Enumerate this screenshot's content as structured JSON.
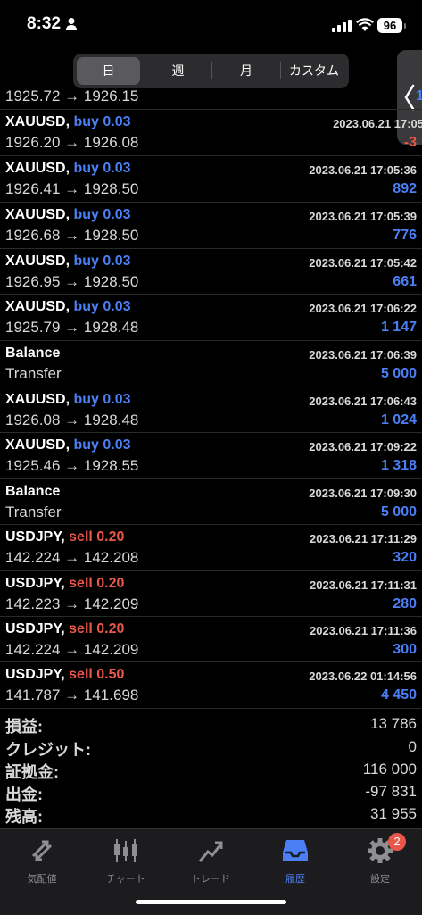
{
  "status": {
    "time": "8:32",
    "battery": "96"
  },
  "segments": [
    "日",
    "週",
    "月",
    "カスタム"
  ],
  "active_segment": 0,
  "rows": [
    {
      "l1a": "",
      "l1b": "",
      "side": "",
      "prices": "1925.72 → 1926.15",
      "date": "",
      "value": "1",
      "neg": false
    },
    {
      "l1a": "XAUUSD, ",
      "l1b": "buy 0.03",
      "side": "buy",
      "prices": "1926.20 → 1926.08",
      "date": "2023.06.21 17:05",
      "value": "-3",
      "neg": true
    },
    {
      "l1a": "XAUUSD, ",
      "l1b": "buy 0.03",
      "side": "buy",
      "prices": "1926.41 → 1928.50",
      "date": "2023.06.21 17:05:36",
      "value": "892",
      "neg": false
    },
    {
      "l1a": "XAUUSD, ",
      "l1b": "buy 0.03",
      "side": "buy",
      "prices": "1926.68 → 1928.50",
      "date": "2023.06.21 17:05:39",
      "value": "776",
      "neg": false
    },
    {
      "l1a": "XAUUSD, ",
      "l1b": "buy 0.03",
      "side": "buy",
      "prices": "1926.95 → 1928.50",
      "date": "2023.06.21 17:05:42",
      "value": "661",
      "neg": false
    },
    {
      "l1a": "XAUUSD, ",
      "l1b": "buy 0.03",
      "side": "buy",
      "prices": "1925.79 → 1928.48",
      "date": "2023.06.21 17:06:22",
      "value": "1 147",
      "neg": false
    },
    {
      "l1a": "Balance",
      "l1b": "",
      "side": "",
      "prices": "Transfer",
      "date": "2023.06.21 17:06:39",
      "value": "5 000",
      "neg": false
    },
    {
      "l1a": "XAUUSD, ",
      "l1b": "buy 0.03",
      "side": "buy",
      "prices": "1926.08 → 1928.48",
      "date": "2023.06.21 17:06:43",
      "value": "1 024",
      "neg": false
    },
    {
      "l1a": "XAUUSD, ",
      "l1b": "buy 0.03",
      "side": "buy",
      "prices": "1925.46 → 1928.55",
      "date": "2023.06.21 17:09:22",
      "value": "1 318",
      "neg": false
    },
    {
      "l1a": "Balance",
      "l1b": "",
      "side": "",
      "prices": "Transfer",
      "date": "2023.06.21 17:09:30",
      "value": "5 000",
      "neg": false
    },
    {
      "l1a": "USDJPY, ",
      "l1b": "sell 0.20",
      "side": "sell",
      "prices": "142.224 → 142.208",
      "date": "2023.06.21 17:11:29",
      "value": "320",
      "neg": false
    },
    {
      "l1a": "USDJPY, ",
      "l1b": "sell 0.20",
      "side": "sell",
      "prices": "142.223 → 142.209",
      "date": "2023.06.21 17:11:31",
      "value": "280",
      "neg": false
    },
    {
      "l1a": "USDJPY, ",
      "l1b": "sell 0.20",
      "side": "sell",
      "prices": "142.224 → 142.209",
      "date": "2023.06.21 17:11:36",
      "value": "300",
      "neg": false
    },
    {
      "l1a": "USDJPY, ",
      "l1b": "sell 0.50",
      "side": "sell",
      "prices": "141.787 → 141.698",
      "date": "2023.06.22 01:14:56",
      "value": "4 450",
      "neg": false
    }
  ],
  "summary": [
    {
      "label": "損益:",
      "value": "13 786"
    },
    {
      "label": "クレジット:",
      "value": "0"
    },
    {
      "label": "証拠金:",
      "value": "116 000"
    },
    {
      "label": "出金:",
      "value": "-97 831"
    },
    {
      "label": "残高:",
      "value": "31 955"
    }
  ],
  "tabs": [
    {
      "label": "気配値",
      "icon": "quotes-icon"
    },
    {
      "label": "チャート",
      "icon": "chart-icon"
    },
    {
      "label": "トレード",
      "icon": "trade-icon"
    },
    {
      "label": "履歴",
      "icon": "history-icon"
    },
    {
      "label": "設定",
      "icon": "settings-icon"
    }
  ],
  "active_tab": 3,
  "settings_badge": "2",
  "colors": {
    "buy": "#4b7ff5",
    "sell": "#e9564a",
    "profit": "#4b7ff5",
    "loss": "#e9564a",
    "active_tab": "#4b7ff5"
  }
}
